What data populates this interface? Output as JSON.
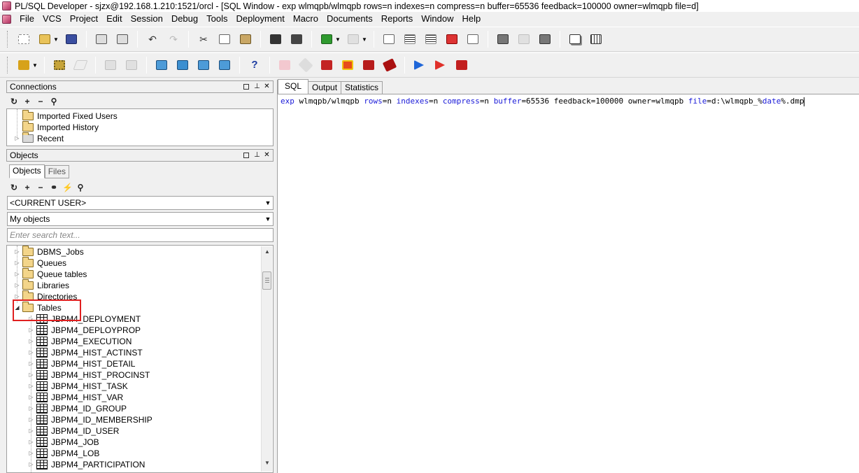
{
  "window": {
    "title": "PL/SQL Developer - sjzx@192.168.1.210:1521/orcl - [SQL Window - exp wlmqpb/wlmqpb rows=n indexes=n compress=n buffer=65536 feedback=100000 owner=wlmqpb file=d]"
  },
  "menu": [
    "File",
    "VCS",
    "Project",
    "Edit",
    "Session",
    "Debug",
    "Tools",
    "Deployment",
    "Macro",
    "Documents",
    "Reports",
    "Window",
    "Help"
  ],
  "connections": {
    "title": "Connections",
    "items": [
      {
        "label": "Imported Fixed Users",
        "expandable": false
      },
      {
        "label": "Imported History",
        "expandable": false
      },
      {
        "label": "Recent",
        "expandable": true
      }
    ]
  },
  "objects": {
    "title": "Objects",
    "tabs": [
      "Objects",
      "Files"
    ],
    "user_combo": "<CURRENT USER>",
    "filter_combo": "My objects",
    "search_placeholder": "Enter search text...",
    "folders": [
      "DBMS_Jobs",
      "Queues",
      "Queue tables",
      "Libraries",
      "Directories"
    ],
    "tables_folder": "Tables",
    "tables": [
      "JBPM4_DEPLOYMENT",
      "JBPM4_DEPLOYPROP",
      "JBPM4_EXECUTION",
      "JBPM4_HIST_ACTINST",
      "JBPM4_HIST_DETAIL",
      "JBPM4_HIST_PROCINST",
      "JBPM4_HIST_TASK",
      "JBPM4_HIST_VAR",
      "JBPM4_ID_GROUP",
      "JBPM4_ID_MEMBERSHIP",
      "JBPM4_ID_USER",
      "JBPM4_JOB",
      "JBPM4_LOB",
      "JBPM4_PARTICIPATION"
    ]
  },
  "editor_tabs": [
    "SQL",
    "Output",
    "Statistics"
  ],
  "sql": {
    "parts": [
      {
        "t": "exp",
        "kw": true
      },
      {
        "t": " wlmqpb/wlmqpb ",
        "kw": false
      },
      {
        "t": "rows",
        "kw": true
      },
      {
        "t": "=n ",
        "kw": false
      },
      {
        "t": "indexes",
        "kw": true
      },
      {
        "t": "=n ",
        "kw": false
      },
      {
        "t": "compress",
        "kw": true
      },
      {
        "t": "=n ",
        "kw": false
      },
      {
        "t": "buffer",
        "kw": true
      },
      {
        "t": "=65536 feedback=100000 owner=wlmqpb ",
        "kw": false
      },
      {
        "t": "file",
        "kw": true
      },
      {
        "t": "=d:\\wlmqpb_%",
        "kw": false
      },
      {
        "t": "date",
        "kw": true
      },
      {
        "t": "%.dmp",
        "kw": false
      }
    ]
  },
  "colors": {
    "keyword": "#1a1ad8",
    "highlight": "#e02020"
  }
}
